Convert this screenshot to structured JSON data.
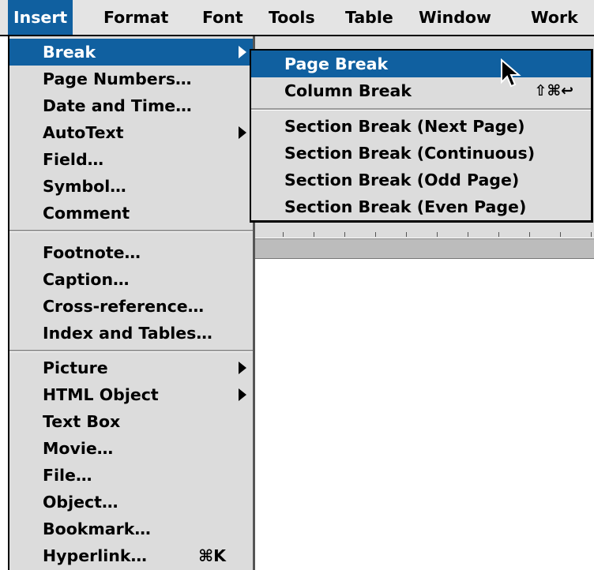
{
  "menubar": {
    "items": [
      "Insert",
      "Format",
      "Font",
      "Tools",
      "Table",
      "Window",
      "Work"
    ]
  },
  "insert_menu": {
    "group1": [
      "Break",
      "Page Numbers…",
      "Date and Time…",
      "AutoText",
      "Field…",
      "Symbol…",
      "Comment"
    ],
    "group2": [
      "Footnote…",
      "Caption…",
      "Cross-reference…",
      "Index and Tables…"
    ],
    "group3": [
      "Picture",
      "HTML Object",
      "Text Box",
      "Movie…",
      "File…",
      "Object…",
      "Bookmark…",
      "Hyperlink…"
    ],
    "hyperlink_shortcut": "⌘K"
  },
  "break_submenu": {
    "items": [
      "Page Break",
      "Column Break",
      "Section Break (Next Page)",
      "Section Break (Continuous)",
      "Section Break (Odd Page)",
      "Section Break (Even Page)"
    ],
    "column_break_shortcut": "⇧⌘↩"
  },
  "icons": {
    "submenu_arrow": "triangle-right-icon",
    "cursor": "arrow-pointer-icon"
  },
  "colors": {
    "highlight": "#1060a0",
    "menu_bg": "#dcdcdc"
  }
}
